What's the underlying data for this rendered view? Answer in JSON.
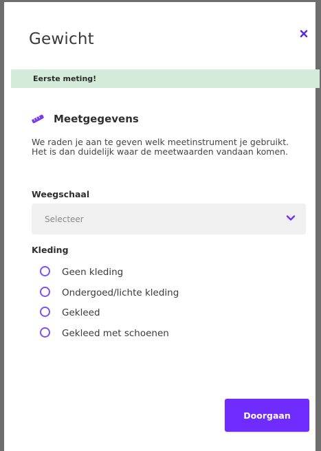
{
  "dialog": {
    "title": "Gewicht",
    "close_icon": "close-icon"
  },
  "banner": {
    "text": "Eerste meting!",
    "color": "#d5ebd9"
  },
  "section": {
    "icon": "tape-measure-icon",
    "title": "Meetgegevens",
    "description": "We raden je aan te geven welk meetinstrument je gebruikt. Het is dan duidelijk waar de meetwaarden vandaan komen."
  },
  "scale": {
    "label": "Weegschaal",
    "placeholder": "Selecteer",
    "chevron_icon": "chevron-down-icon"
  },
  "clothing": {
    "label": "Kleding",
    "options": [
      {
        "label": "Geen kleding",
        "selected": false
      },
      {
        "label": "Ondergoed/lichte kleding",
        "selected": false
      },
      {
        "label": "Gekleed",
        "selected": false
      },
      {
        "label": "Gekleed met schoenen",
        "selected": false
      }
    ]
  },
  "footer": {
    "continue_label": "Doorgaan"
  },
  "colors": {
    "accent": "#6f2cff",
    "radio": "#7c4dff"
  }
}
